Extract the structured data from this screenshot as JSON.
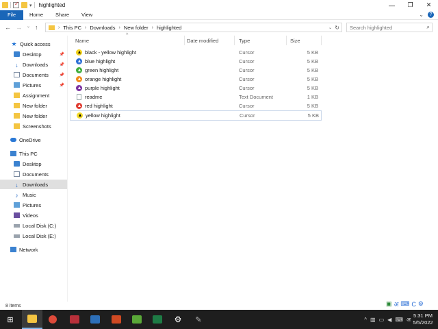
{
  "window": {
    "title": "highlighted"
  },
  "ribbon": {
    "tabs": [
      "File",
      "Home",
      "Share",
      "View"
    ]
  },
  "address": {
    "crumbs": [
      "This PC",
      "Downloads",
      "New folder",
      "highlighted"
    ],
    "search_placeholder": "Search highlighted"
  },
  "nav": {
    "quick_access": "Quick access",
    "pinned": [
      "Desktop",
      "Downloads",
      "Documents",
      "Pictures"
    ],
    "folders": [
      "Assignment",
      "New folder",
      "New folder",
      "Screenshots"
    ],
    "onedrive": "OneDrive",
    "this_pc": "This PC",
    "pc_items": [
      "Desktop",
      "Documents",
      "Downloads",
      "Music",
      "Pictures",
      "Videos",
      "Local Disk (C:)",
      "Local Disk (E:)"
    ],
    "network": "Network"
  },
  "columns": {
    "name": "Name",
    "date": "Date modified",
    "type": "Type",
    "size": "Size"
  },
  "files": [
    {
      "name": "black - yellow highlight",
      "type": "Cursor",
      "size": "5 KB",
      "color": "#f2d21b"
    },
    {
      "name": "blue highlight",
      "type": "Cursor",
      "size": "5 KB",
      "color": "#2b6fd6"
    },
    {
      "name": "green highlight",
      "type": "Cursor",
      "size": "5 KB",
      "color": "#3fae3a"
    },
    {
      "name": "orange highlight",
      "type": "Cursor",
      "size": "5 KB",
      "color": "#f28a1a"
    },
    {
      "name": "purple highlight",
      "type": "Cursor",
      "size": "5 KB",
      "color": "#7a2fa0"
    },
    {
      "name": "readme",
      "type": "Text Document",
      "size": "1 KB",
      "color": ""
    },
    {
      "name": "red highlight",
      "type": "Cursor",
      "size": "5 KB",
      "color": "#e03a2f"
    },
    {
      "name": "yellow highlight",
      "type": "Cursor",
      "size": "5 KB",
      "color": "#f5dc2a"
    }
  ],
  "status": {
    "item_count": "8 items"
  },
  "clock": {
    "time": "5:31 PM",
    "date": "5/5/2022"
  },
  "tray": {
    "lang": "अ",
    "ime": "C"
  }
}
